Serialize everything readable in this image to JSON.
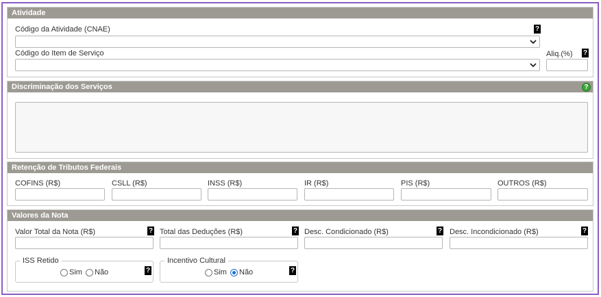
{
  "atividade": {
    "title": "Atividade",
    "cnae_label": "Código da Atividade (CNAE)",
    "item_servico_label": "Código do Item de Serviço",
    "aliq_label": "Aliq.(%)",
    "help_glyph": "?"
  },
  "discriminacao": {
    "title": "Discriminação dos Serviços",
    "help_glyph": "?"
  },
  "retencao": {
    "title": "Retenção de Tributos Federais",
    "fields": [
      {
        "label": "COFINS (R$)"
      },
      {
        "label": "CSLL (R$)"
      },
      {
        "label": "INSS (R$)"
      },
      {
        "label": "IR (R$)"
      },
      {
        "label": "PIS (R$)"
      },
      {
        "label": "OUTROS (R$)"
      }
    ]
  },
  "valores": {
    "title": "Valores da Nota",
    "fields": [
      {
        "label": "Valor Total da Nota (R$)"
      },
      {
        "label": "Total das Deduções (R$)"
      },
      {
        "label": "Desc. Condicionado (R$)"
      },
      {
        "label": "Desc. Incondicionado (R$)"
      }
    ],
    "iss_retido": {
      "legend": "ISS Retido",
      "opt_sim": "Sim",
      "opt_nao": "Não",
      "selected": ""
    },
    "incentivo": {
      "legend": "Incentivo Cultural",
      "opt_sim": "Sim",
      "opt_nao": "Não",
      "selected": "Não"
    },
    "help_glyph": "?"
  },
  "colors": {
    "header_bg": "#9d9a93",
    "frame_border": "#8a5cc2",
    "radio_checked": "#1a6fd6",
    "help_green": "#3aa53a"
  }
}
